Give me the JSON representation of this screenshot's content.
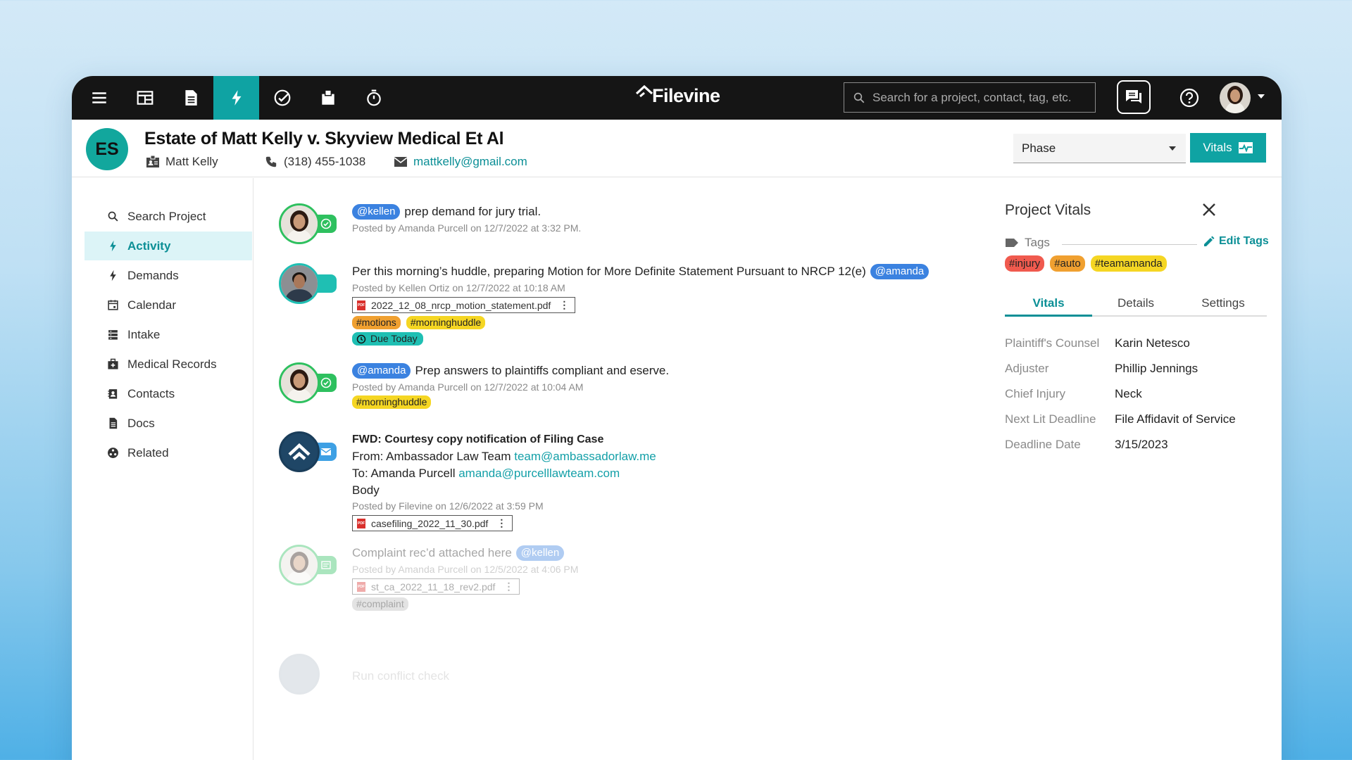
{
  "app": {
    "logo_text": "Filevine",
    "search_placeholder": "Search for a project, contact, tag, etc."
  },
  "project": {
    "initials": "ES",
    "title": "Estate of Matt Kelly v. Skyview Medical Et Al",
    "client": "Matt Kelly",
    "phone": "(318) 455-1038",
    "email": "mattkelly@gmail.com",
    "phase_label": "Phase",
    "vitals_button": "Vitals"
  },
  "nav": [
    {
      "label": "Search Project",
      "icon": "search-icon"
    },
    {
      "label": "Activity",
      "icon": "lightning-icon",
      "active": true
    },
    {
      "label": "Demands",
      "icon": "lightning-icon"
    },
    {
      "label": "Calendar",
      "icon": "calendar-icon"
    },
    {
      "label": "Intake",
      "icon": "intake-icon"
    },
    {
      "label": "Medical Records",
      "icon": "medical-kit-icon"
    },
    {
      "label": "Contacts",
      "icon": "contacts-icon"
    },
    {
      "label": "Docs",
      "icon": "document-icon"
    },
    {
      "label": "Related",
      "icon": "related-icon"
    }
  ],
  "feed": {
    "post1": {
      "mention": "@kellen",
      "text": "prep demand for jury trial.",
      "by": "Posted by Amanda Purcell on 12/7/2022 at 3:32 PM."
    },
    "post2": {
      "text": "Per this morning’s huddle, preparing Motion for More Definite Statement Pursuant to NRCP 12(e)",
      "mention": "@amanda",
      "by": "Posted by Kellen Ortiz on 12/7/2022 at 10:18 AM",
      "file": "2022_12_08_nrcp_motion_statement.pdf",
      "tags": [
        "#motions",
        "#morninghuddle"
      ],
      "due": "Due Today"
    },
    "post3": {
      "mention": "@amanda",
      "text": "Prep answers to plaintiffs compliant and eserve.",
      "by": "Posted by Amanda Purcell on 12/7/2022 at 10:04 AM",
      "tags": [
        "#morninghuddle"
      ]
    },
    "post4": {
      "subject": "FWD: Courtesy copy notification of Filing Case",
      "from_label": "From: Ambassador Law Team",
      "from_email": "team@ambassadorlaw.me",
      "to_label": "To: Amanda Purcell",
      "to_email": "amanda@purcelllawteam.com",
      "body": "Body",
      "by": "Posted by Filevine on 12/6/2022 at 3:59 PM",
      "file": "casefiling_2022_11_30.pdf"
    },
    "post5": {
      "text": "Complaint rec’d attached here",
      "mention": "@kellen",
      "by": "Posted by Amanda Purcell on 12/5/2022 at 4:06 PM",
      "file": "st_ca_2022_11_18_rev2.pdf",
      "tags": [
        "#complaint"
      ]
    },
    "post6": {
      "text": "Run conflict check"
    }
  },
  "vitals": {
    "title": "Project Vitals",
    "tags_label": "Tags",
    "edit_tags": "Edit Tags",
    "tags": [
      "#injury",
      "#auto",
      "#teamamanda"
    ],
    "tabs": [
      "Vitals",
      "Details",
      "Settings"
    ],
    "active_tab": "Vitals",
    "rows": [
      {
        "key": "Plaintiff's Counsel",
        "value": "Karin Netesco"
      },
      {
        "key": "Adjuster",
        "value": "Phillip Jennings"
      },
      {
        "key": "Chief Injury",
        "value": "Neck"
      },
      {
        "key": "Next Lit Deadline",
        "value": "File Affidavit of Service"
      },
      {
        "key": "Deadline Date",
        "value": "3/15/2023"
      }
    ]
  },
  "colors": {
    "brand_teal": "#0fa3a3",
    "topbar": "#151515",
    "mention_blue": "#3b82e0",
    "tag_orange": "#f0a030",
    "tag_yellow": "#f5d623",
    "tag_red": "#f05a4e"
  }
}
